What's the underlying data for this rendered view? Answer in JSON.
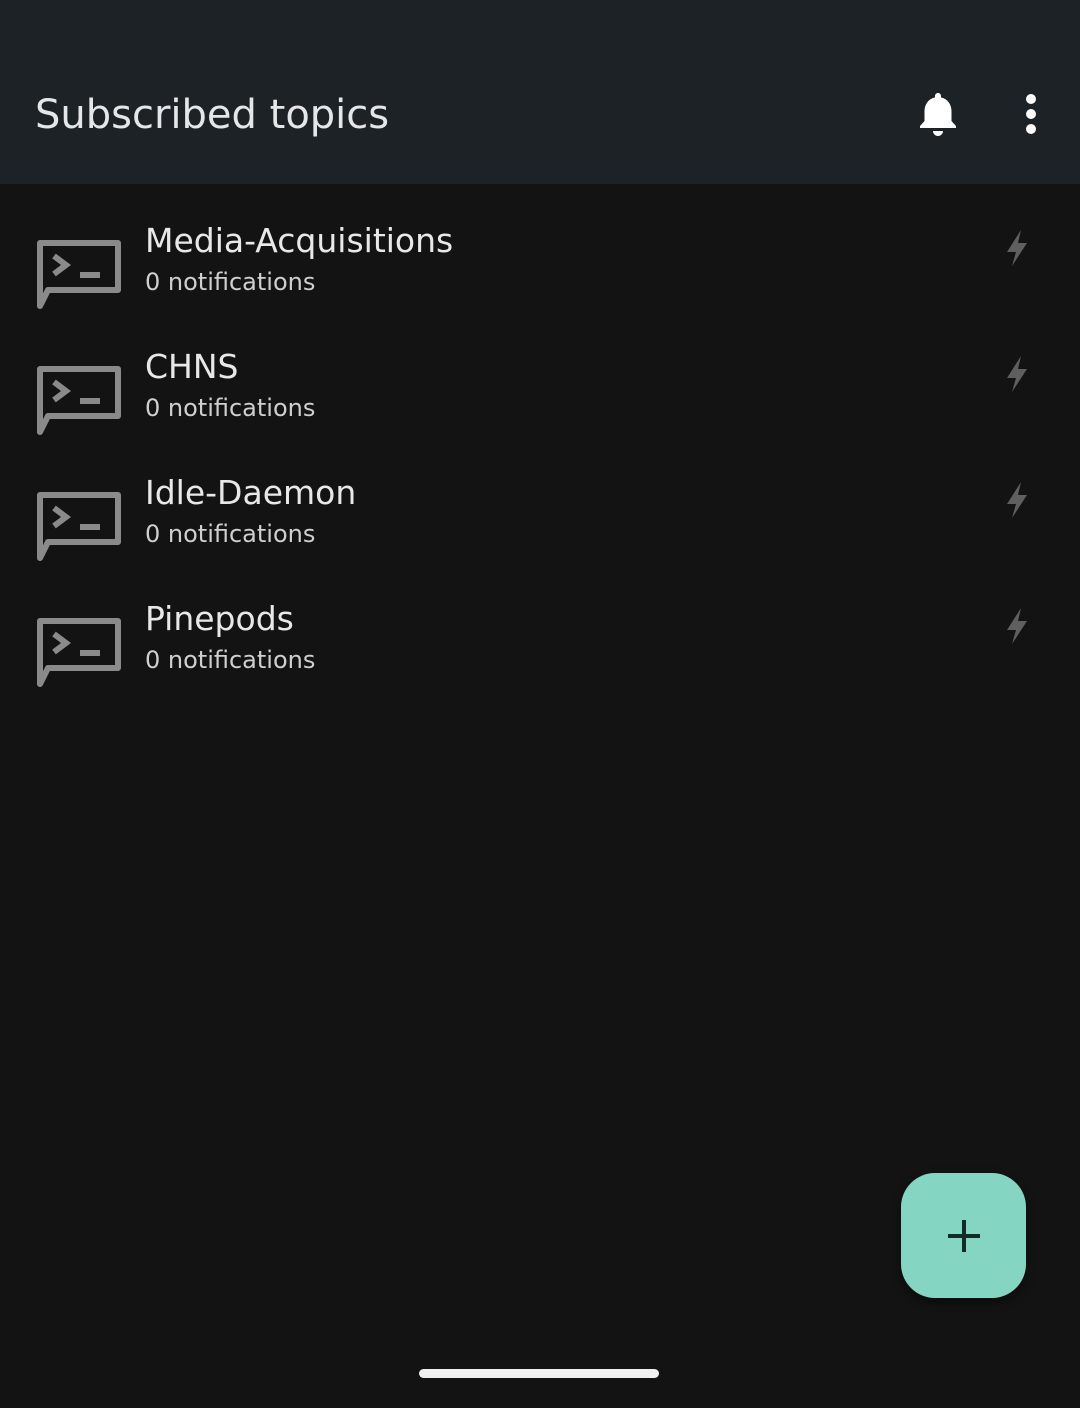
{
  "appbar": {
    "title": "Subscribed topics",
    "bell_icon": "bell-icon",
    "more_icon": "more-vert-icon"
  },
  "topics": [
    {
      "name": "Media-Acquisitions",
      "count": "0 notifications",
      "icon": "terminal-icon",
      "status_icon": "bolt-icon"
    },
    {
      "name": "CHNS",
      "count": "0 notifications",
      "icon": "terminal-icon",
      "status_icon": "bolt-icon"
    },
    {
      "name": "Idle-Daemon",
      "count": "0 notifications",
      "icon": "terminal-icon",
      "status_icon": "bolt-icon"
    },
    {
      "name": "Pinepods",
      "count": "0 notifications",
      "icon": "terminal-icon",
      "status_icon": "bolt-icon"
    }
  ],
  "fab": {
    "icon": "plus-icon"
  },
  "colors": {
    "appbar_bg": "#1d2226",
    "body_bg": "#131313",
    "fab_bg": "#84d6c3",
    "icon_gray": "#8a8a8a",
    "bolt_gray": "#5f5f5f"
  }
}
